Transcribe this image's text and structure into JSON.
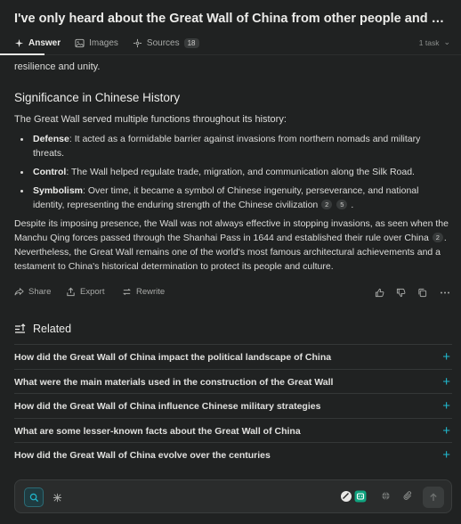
{
  "header": {
    "title": "I've only heard about the Great Wall of China from other people and don't know the…",
    "tabs": [
      {
        "label": "Answer"
      },
      {
        "label": "Images"
      },
      {
        "label": "Sources",
        "badge": "18"
      }
    ],
    "task_count": "1 task"
  },
  "answer": {
    "cut_text": "resilience and unity.",
    "section_title": "Significance in Chinese History",
    "intro": "The Great Wall served multiple functions throughout its history:",
    "bullets": [
      {
        "term": "Defense",
        "text": ": It acted as a formidable barrier against invasions from northern nomads and military threats."
      },
      {
        "term": "Control",
        "text": ": The Wall helped regulate trade, migration, and communication along the Silk Road."
      },
      {
        "term": "Symbolism",
        "text": ": Over time, it became a symbol of Chinese ingenuity, perseverance, and national identity, representing the enduring strength of the Chinese civilization",
        "cites": [
          "2",
          "5"
        ],
        "end": "."
      }
    ],
    "para_a": "Despite its imposing presence, the Wall was not always effective in stopping invasions, as seen when the Manchu Qing forces passed through the Shanhai Pass in 1644 and established their rule over China",
    "para_cite": "2",
    "para_b": ". Nevertheless, the Great Wall remains one of the world's most famous architectural achievements and a testament to China's historical determination to protect its people and culture."
  },
  "actions": {
    "share": "Share",
    "export": "Export",
    "rewrite": "Rewrite"
  },
  "related": {
    "title": "Related",
    "items": [
      "How did the Great Wall of China impact the political landscape of China",
      "What were the main materials used in the construction of the Great Wall",
      "How did the Great Wall of China influence Chinese military strategies",
      "What are some lesser-known facts about the Great Wall of China",
      "How did the Great Wall of China evolve over the centuries"
    ],
    "plus_glyph": "+"
  },
  "colors": {
    "accent": "#20b8cd",
    "background": "#202222"
  }
}
